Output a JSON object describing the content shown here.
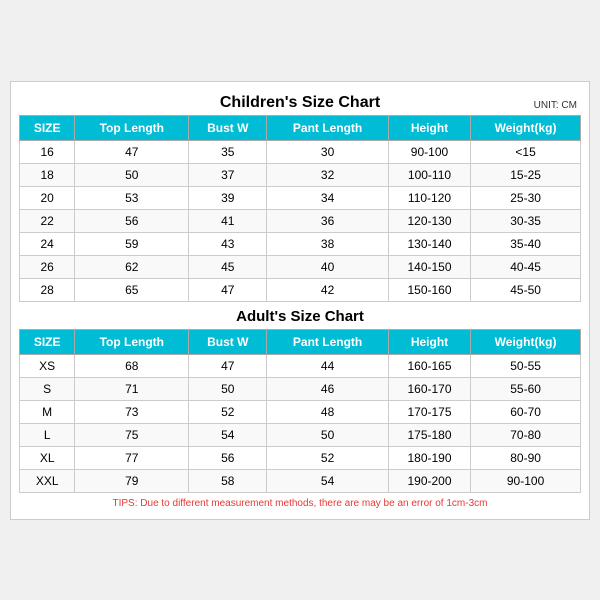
{
  "page": {
    "unit": "UNIT: CM",
    "children": {
      "title": "Children's Size Chart",
      "headers": [
        "SIZE",
        "Top Length",
        "Bust W",
        "Pant Length",
        "Height",
        "Weight(kg)"
      ],
      "rows": [
        [
          "16",
          "47",
          "35",
          "30",
          "90-100",
          "<15"
        ],
        [
          "18",
          "50",
          "37",
          "32",
          "100-110",
          "15-25"
        ],
        [
          "20",
          "53",
          "39",
          "34",
          "110-120",
          "25-30"
        ],
        [
          "22",
          "56",
          "41",
          "36",
          "120-130",
          "30-35"
        ],
        [
          "24",
          "59",
          "43",
          "38",
          "130-140",
          "35-40"
        ],
        [
          "26",
          "62",
          "45",
          "40",
          "140-150",
          "40-45"
        ],
        [
          "28",
          "65",
          "47",
          "42",
          "150-160",
          "45-50"
        ]
      ]
    },
    "adults": {
      "title": "Adult's Size Chart",
      "headers": [
        "SIZE",
        "Top Length",
        "Bust W",
        "Pant Length",
        "Height",
        "Weight(kg)"
      ],
      "rows": [
        [
          "XS",
          "68",
          "47",
          "44",
          "160-165",
          "50-55"
        ],
        [
          "S",
          "71",
          "50",
          "46",
          "160-170",
          "55-60"
        ],
        [
          "M",
          "73",
          "52",
          "48",
          "170-175",
          "60-70"
        ],
        [
          "L",
          "75",
          "54",
          "50",
          "175-180",
          "70-80"
        ],
        [
          "XL",
          "77",
          "56",
          "52",
          "180-190",
          "80-90"
        ],
        [
          "XXL",
          "79",
          "58",
          "54",
          "190-200",
          "90-100"
        ]
      ]
    },
    "tips": "TIPS: Due to different measurement methods, there are may be an error of 1cm-3cm"
  }
}
